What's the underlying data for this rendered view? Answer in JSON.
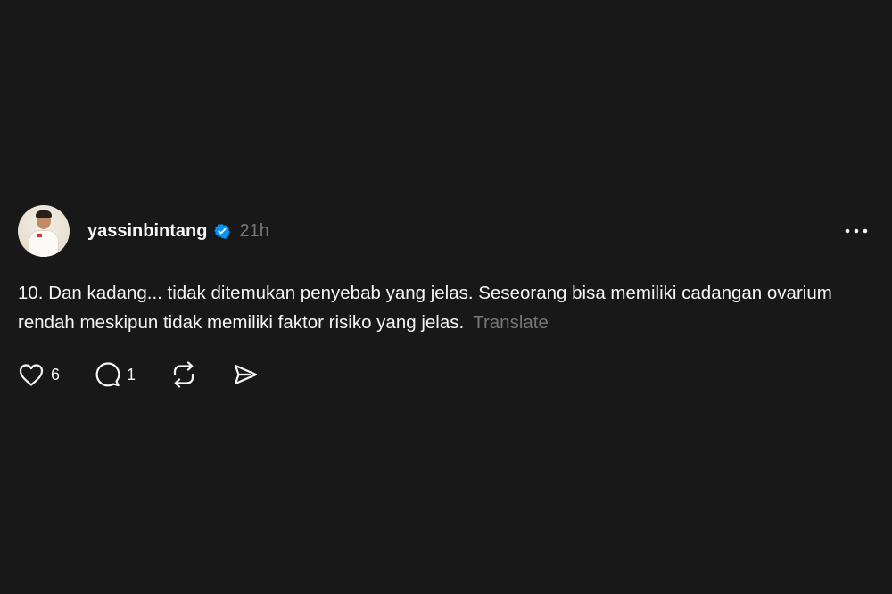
{
  "post": {
    "username": "yassinbintang",
    "verified": true,
    "timestamp": "21h",
    "text": "10. Dan kadang... tidak ditemukan penyebab yang jelas. Seseorang bisa memiliki cadangan ovarium rendah meskipun tidak memiliki faktor risiko yang jelas.",
    "translate_label": "Translate",
    "likes": "6",
    "replies": "1"
  },
  "icons": {
    "verified": "verified-badge-icon",
    "more": "more-options-icon",
    "like": "heart-icon",
    "reply": "comment-icon",
    "repost": "repost-icon",
    "share": "send-icon"
  },
  "colors": {
    "background": "#181818",
    "text": "#f3f5f7",
    "muted": "#777777",
    "verified": "#0095f6"
  }
}
